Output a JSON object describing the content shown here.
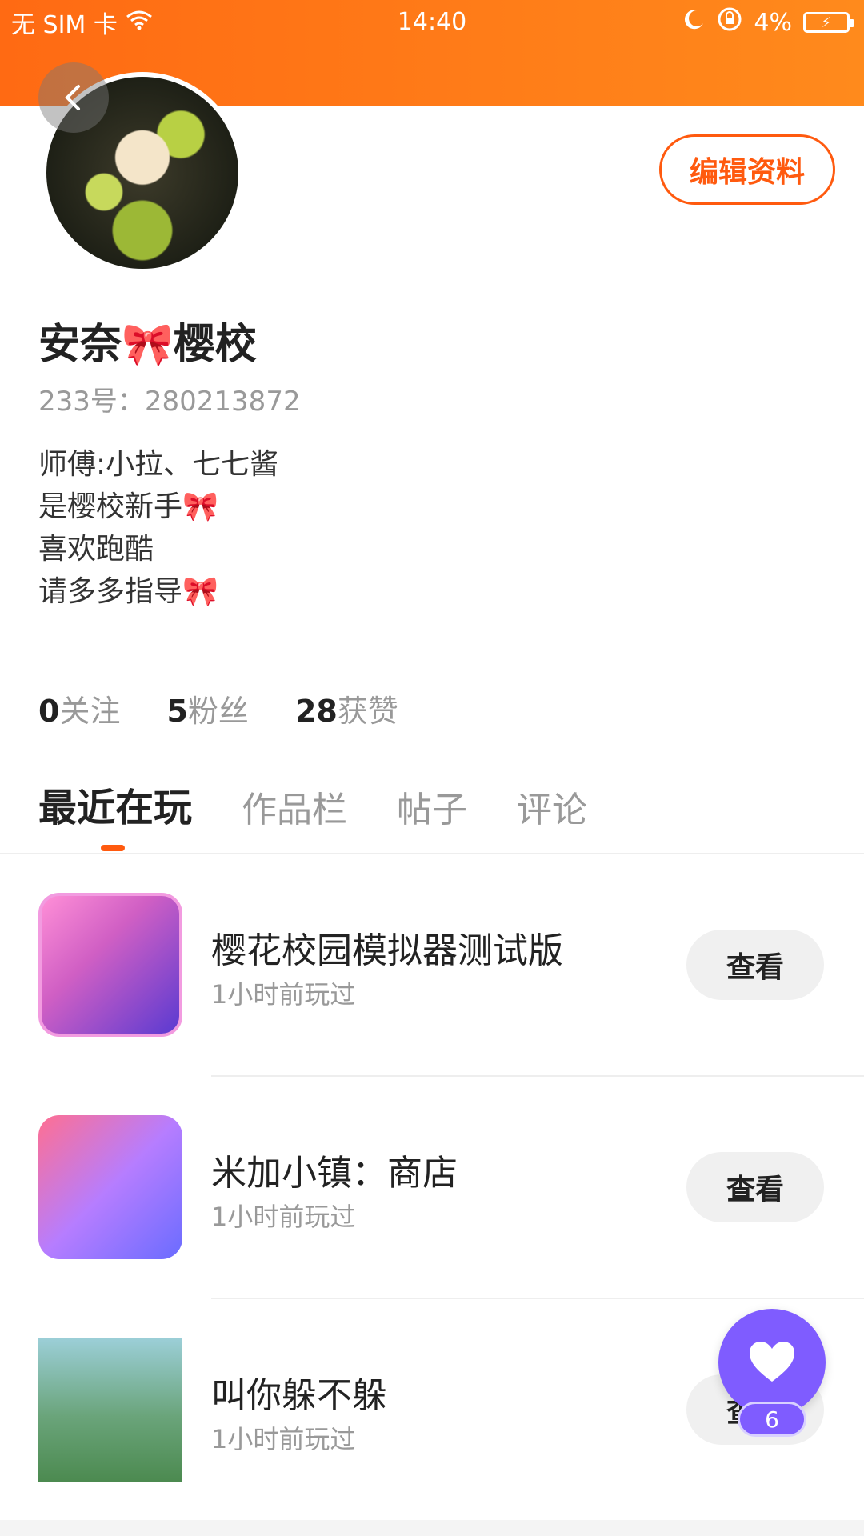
{
  "status_bar": {
    "carrier": "无 SIM 卡",
    "time": "14:40",
    "battery": "4%"
  },
  "profile": {
    "edit_label": "编辑资料",
    "nickname": "安奈🎀樱校",
    "uid": "233号：280213872",
    "bio": [
      "师傅:小拉、七七酱",
      "是樱校新手🎀",
      "喜欢跑酷",
      "请多多指导🎀"
    ]
  },
  "stats": [
    {
      "num": "0",
      "label": "关注"
    },
    {
      "num": "5",
      "label": "粉丝"
    },
    {
      "num": "28",
      "label": "获赞"
    }
  ],
  "tabs": [
    "最近在玩",
    "作品栏",
    "帖子",
    "评论"
  ],
  "games": [
    {
      "title": "樱花校园模拟器测试版",
      "subtitle": "1小时前玩过",
      "button": "查看"
    },
    {
      "title": "米加小镇：商店",
      "subtitle": "1小时前玩过",
      "button": "查看"
    },
    {
      "title": "叫你躲不躲",
      "subtitle": "1小时前玩过",
      "button": "查看"
    }
  ],
  "fab": {
    "count": "6"
  },
  "colors": {
    "accent": "#ff5a0f",
    "header": "#ff7518",
    "fab": "#7f5cff"
  }
}
